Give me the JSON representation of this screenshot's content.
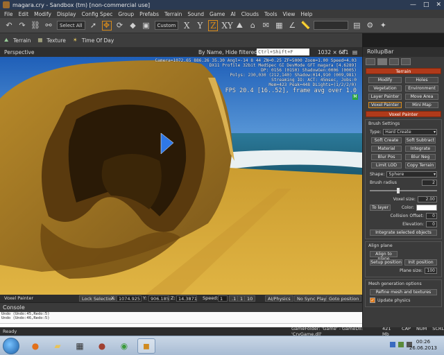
{
  "window": {
    "title": "magara.cry - Sandbox (tm) [non-commercial use]",
    "controls": [
      "—",
      "□",
      "✕"
    ]
  },
  "menu": [
    "File",
    "Edit",
    "Modify",
    "Display",
    "Config Spec",
    "Group",
    "Prefabs",
    "Terrain",
    "Sound",
    "Game",
    "AI",
    "Clouds",
    "Tools",
    "View",
    "Help"
  ],
  "toolbar": {
    "select_all": "Select All",
    "custom": "Custom",
    "axis_x": "X",
    "axis_y": "Y",
    "axis_z": "Z",
    "axis_xy": "XY"
  },
  "toolbar2": {
    "terrain": "Terrain",
    "texture": "Texture",
    "time_of_day": "Time Of Day"
  },
  "viewport": {
    "name": "Perspective",
    "filter_text": "By Name, Hide filtered, AND",
    "search_placeholder": "Ctrl+Shift+F",
    "resolution": "1032 × 681",
    "hud": [
      "Camera=1072.65 886.26 35.30 Angl=-14  8  44 ZN=0.25 ZF=5000 Zoom=1.00 Speed=4.03",
      "DX11 Profile 32bit MedSpec GI DevMode GFT magara [4.6289]",
      "DP: 0156 (0150) ShadowGen:0006 (0005)",
      "Polys: 230,030 (212,140) Shadow:014,910 (009,981)",
      "Streaming IO: ACT: 45msec, Jobs:0",
      "Mem=423 Peak=448 DLights=(1/2/2/0)"
    ],
    "fps": "FPS 20.4 [16..52], frame avg over 1.0",
    "badge": "M"
  },
  "vp_status": {
    "mode": "Voxel Painter",
    "lock": "Lock Selection",
    "x_label": "X:",
    "x_val": "1074.925",
    "y_label": "Y:",
    "y_val": "906.185",
    "z_label": "Z:",
    "z_val": "14.3871",
    "speed_label": "Speed:",
    "speed_val": "1",
    "speed_opts": [
      ".1",
      "1",
      "10"
    ],
    "ai_physics": "AI/Physics",
    "no_sync": "No Sync Player",
    "goto": "Goto position"
  },
  "console": {
    "title": "Console",
    "lines": [
      "Undo (Undo:45,Redo:5)",
      "Undo (Undo:46,Redo:5)"
    ]
  },
  "statusbar": {
    "ready": "Ready",
    "gamefolder": "GameFolder: 'Game' - GameDll: 'CryGame.dll'",
    "mem": "421 Mb",
    "cap": "CAP",
    "num": "NUM",
    "scrl": "SCRL"
  },
  "rollup": {
    "title": "RollupBar",
    "terrain_section": "Terrain",
    "terrain_buttons": [
      "Modify",
      "Holes",
      "Vegetation",
      "Environment",
      "Layer Painter",
      "Move Area",
      "Voxel Painter",
      "Mini Map"
    ],
    "voxel_section": "Voxel Painter",
    "brush_settings": "Brush Settings",
    "type_label": "Type:",
    "type_value": "Hard Create",
    "brush_buttons": [
      "Soft Create",
      "Soft Subtract",
      "Material",
      "Integrate",
      "Blur Pos",
      "Blur Neg",
      "Limit LOD",
      "Copy Terrain"
    ],
    "shape_label": "Shape:",
    "shape_value": "Sphere",
    "radius_label": "Brush radius",
    "radius_value": "2",
    "voxel_size_label": "Voxel size:",
    "voxel_size_value": "2.00",
    "to_layer": "To layer",
    "color_label": "Color:",
    "collision_label": "Collision Offset:",
    "collision_value": "0",
    "elevation_label": "Elevation:",
    "elevation_value": "0",
    "integrate_selected": "Integrate selected objects",
    "align_plane": "Align plane",
    "align_to_plane": "Align to plane",
    "setup_position": "Setup position",
    "init_position": "Init position",
    "plane_size_label": "Plane size:",
    "plane_size_value": "100",
    "mesh_gen": "Mesh generation options",
    "refine": "Refine mesh and textures",
    "update_physics": "Update physics"
  },
  "taskbar": {
    "time": "00:26",
    "date": "26.06.2013"
  }
}
